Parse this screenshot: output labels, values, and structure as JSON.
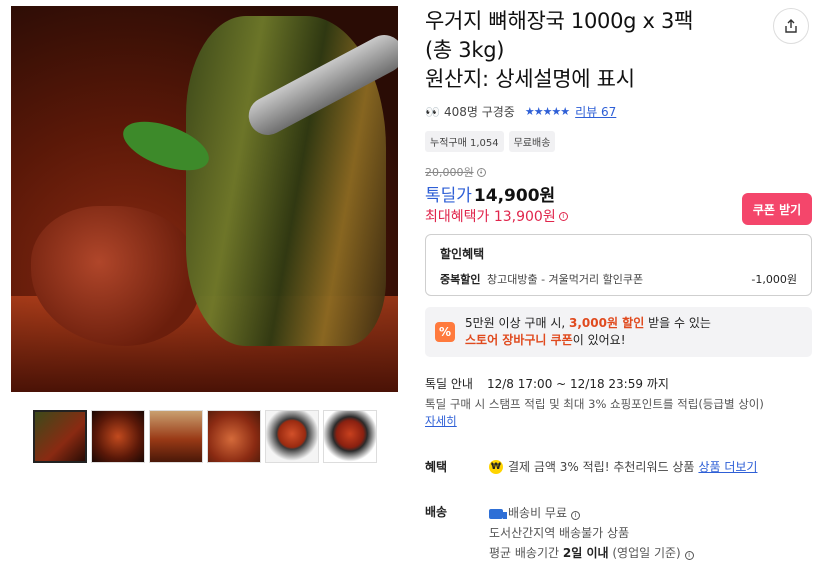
{
  "product": {
    "title_line1": "우거지 뼈해장국 1000g x 3팩",
    "title_line2": "(총 3kg)",
    "title_line3": "원산지: 상세설명에 표시",
    "share_icon": "share-icon"
  },
  "social": {
    "viewers": "408명 구경중",
    "review_label": "리뷰 67",
    "rating_stars": 5
  },
  "badges": [
    "누적구매 1,054",
    "무료배송"
  ],
  "price": {
    "original": "20,000원",
    "deal_label": "톡딜가",
    "deal_value": "14,900원",
    "max_benefit": "최대혜택가 13,900원",
    "coupon_button": "쿠폰 받기"
  },
  "discount": {
    "heading": "할인혜택",
    "row_label": "중복할인",
    "row_desc": "창고대방출 - 겨울먹거리 할인쿠폰",
    "row_amount": "-1,000원"
  },
  "store_banner": {
    "text_a": "5만원 이상 구매 시, ",
    "text_highlight": "3,000원 할인",
    "text_b": " 받을 수 있는",
    "text_highlight2": "스토어 장바구니 쿠폰",
    "text_c": "이 있어요!",
    "icon": "%"
  },
  "deal_info": {
    "label": "톡딜 안내",
    "period": "12/8 17:00 ~ 12/18 23:59 까지",
    "desc": "톡딜 구매 시 스탬프 적립 및 최대 3% 쇼핑포인트를 적립(등급별 상이)",
    "more": "자세히"
  },
  "benefit": {
    "label": "혜택",
    "text": "결제 금액 3% 적립! 추천리워드 상품",
    "link": "상품 더보기",
    "icon": "₩"
  },
  "shipping": {
    "label": "배송",
    "fee": "배송비 무료",
    "note": "도서산간지역 배송불가 상품",
    "avg_a": "평균 배송기간 ",
    "avg_b": "2일 이내",
    "avg_c": " (영업일 기준)"
  },
  "colors": {
    "accent_blue": "#2e5fd6",
    "price_red": "#e0264c",
    "coupon_pink": "#f4466b",
    "banner_orange": "#ff7a3d"
  },
  "thumbnails": [
    "thumb-1",
    "thumb-2",
    "thumb-3",
    "thumb-4",
    "thumb-5",
    "thumb-6"
  ]
}
